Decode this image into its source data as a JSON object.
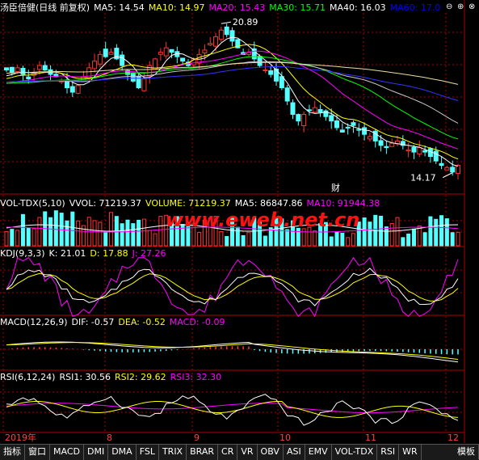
{
  "headers": {
    "main": {
      "title": "汤臣倍健(日线 前复权)",
      "items": [
        {
          "label": "MA5: 14.54",
          "color": "#ffffff"
        },
        {
          "label": "MA10: 14.97",
          "color": "#ffff00"
        },
        {
          "label": "MA20: 15.43",
          "color": "#ff00ff"
        },
        {
          "label": "MA30: 15.71",
          "color": "#00ff00"
        },
        {
          "label": "MA40: 16.03",
          "color": "#ffffff"
        },
        {
          "label": "MA60: 17.0",
          "color": "#0000ff"
        }
      ]
    },
    "vol": {
      "title": "VOL-TDX(5,10)",
      "items": [
        {
          "label": "VVOL: 71219.37",
          "color": "#ffffff"
        },
        {
          "label": "VOLUME: 71219.37",
          "color": "#ffff00"
        },
        {
          "label": "MA5: 86847.86",
          "color": "#ffffff"
        },
        {
          "label": "MA10: 91944.38",
          "color": "#ff00ff"
        }
      ]
    },
    "kdj": {
      "title": "KDJ(9,3,3)",
      "items": [
        {
          "label": "K: 21.01",
          "color": "#ffffff"
        },
        {
          "label": "D: 17.88",
          "color": "#ffff00"
        },
        {
          "label": "J: 27.26",
          "color": "#ff00ff"
        }
      ]
    },
    "macd": {
      "title": "MACD(12,26,9)",
      "items": [
        {
          "label": "DIF: -0.57",
          "color": "#ffffff"
        },
        {
          "label": "DEA: -0.52",
          "color": "#ffff00"
        },
        {
          "label": "MACD: -0.09",
          "color": "#ff00ff"
        }
      ]
    },
    "rsi": {
      "title": "RSI(6,12,24)",
      "items": [
        {
          "label": "RSI1: 30.56",
          "color": "#ffffff"
        },
        {
          "label": "RSI2: 29.62",
          "color": "#ffff00"
        },
        {
          "label": "RSI3: 32.30",
          "color": "#ff00ff"
        }
      ]
    }
  },
  "annotations": {
    "high": "20.89",
    "low": "14.17",
    "event": "财"
  },
  "watermark": "www.eweb.net.cn",
  "window_controls": {
    "minimize": "⊖",
    "restore": "⊕",
    "close": "⊗"
  },
  "months": [
    "2019年",
    "8",
    "9",
    "10",
    "11",
    "12"
  ],
  "bottom_tabs": [
    "指标",
    "窗口",
    "MACD",
    "DMI",
    "DMA",
    "FSL",
    "TRIX",
    "BRAR",
    "CR",
    "VR",
    "OBV",
    "ASI",
    "EMV",
    "VOL-TDX",
    "RSI",
    "WR"
  ],
  "bottom_right_tab": "模板",
  "colors": {
    "up": "#ff3232",
    "down": "#54ffff",
    "grid": "#b00000",
    "bg": "#000000"
  },
  "chart_data": [
    {
      "type": "line",
      "name": "main-price",
      "price_range": [
        13.5,
        21.3
      ],
      "high_marker": 20.89,
      "low_marker": 14.17,
      "ma_latest": {
        "MA5": 14.54,
        "MA10": 14.97,
        "MA20": 15.43,
        "MA30": 15.71,
        "MA40": 16.03,
        "MA60": 17.0
      },
      "close_path": [
        18.8,
        18.7,
        18.9,
        18.6,
        18.4,
        18.7,
        19.0,
        18.8,
        18.6,
        18.5,
        18.3,
        18.0,
        17.8,
        18.1,
        18.5,
        18.9,
        19.2,
        19.5,
        19.4,
        19.6,
        19.3,
        19.0,
        18.6,
        18.3,
        18.0,
        18.4,
        19.0,
        19.3,
        19.6,
        19.8,
        19.6,
        19.4,
        19.2,
        19.0,
        19.3,
        19.5,
        19.7,
        20.0,
        20.3,
        20.6,
        20.4,
        20.1,
        19.8,
        19.5,
        19.6,
        19.3,
        19.0,
        18.8,
        18.6,
        18.3,
        18.0,
        17.4,
        16.8,
        16.5,
        16.8,
        17.0,
        17.1,
        16.9,
        16.7,
        16.5,
        16.2,
        16.0,
        16.2,
        16.3,
        16.1,
        15.9,
        15.8,
        15.6,
        15.4,
        15.3,
        15.5,
        15.6,
        15.4,
        15.2,
        15.1,
        15.3,
        15.1,
        14.9,
        14.7,
        14.5,
        14.4,
        14.2,
        14.5
      ]
    },
    {
      "type": "bar",
      "name": "volume",
      "latest": {
        "VVOL": 71219.37,
        "VOLUME": 71219.37,
        "MA5": 86847.86,
        "MA10": 91944.38
      }
    },
    {
      "type": "line",
      "name": "kdj",
      "latest": {
        "K": 21.01,
        "D": 17.88,
        "J": 27.26
      }
    },
    {
      "type": "line",
      "name": "macd",
      "latest": {
        "DIF": -0.57,
        "DEA": -0.52,
        "MACD": -0.09
      }
    },
    {
      "type": "line",
      "name": "rsi",
      "latest": {
        "RSI1": 30.56,
        "RSI2": 29.62,
        "RSI3": 32.3
      }
    }
  ]
}
